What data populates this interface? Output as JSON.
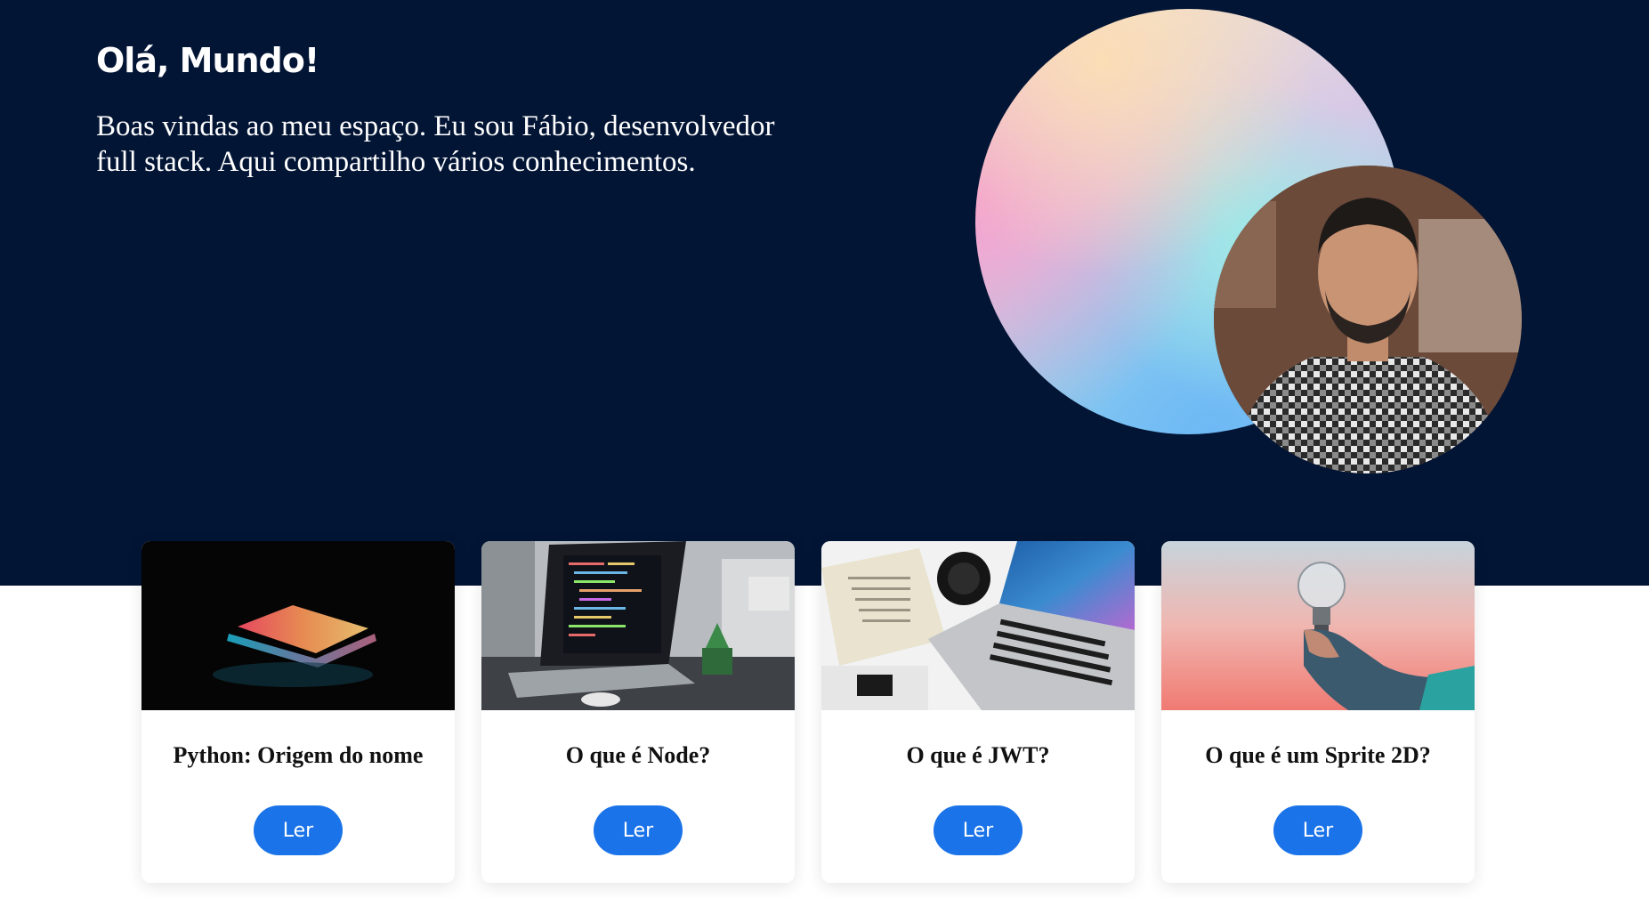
{
  "hero": {
    "title": "Olá, Mundo!",
    "subtitle": "Boas vindas ao meu espaço. Eu sou Fábio, desenvolvedor full stack. Aqui compartilho vários conhecimentos.",
    "background_color": "#031535"
  },
  "posts": [
    {
      "title": "Python: Origem do nome",
      "button_label": "Ler",
      "image": "laptop-dark-photo"
    },
    {
      "title": "O que é Node?",
      "button_label": "Ler",
      "image": "laptop-code-photo"
    },
    {
      "title": "O que é JWT?",
      "button_label": "Ler",
      "image": "desk-laptop-camera-photo"
    },
    {
      "title": "O que é um Sprite 2D?",
      "button_label": "Ler",
      "image": "lightbulb-hand-photo"
    }
  ],
  "colors": {
    "accent": "#1a73e8",
    "hero_bg": "#031535"
  }
}
